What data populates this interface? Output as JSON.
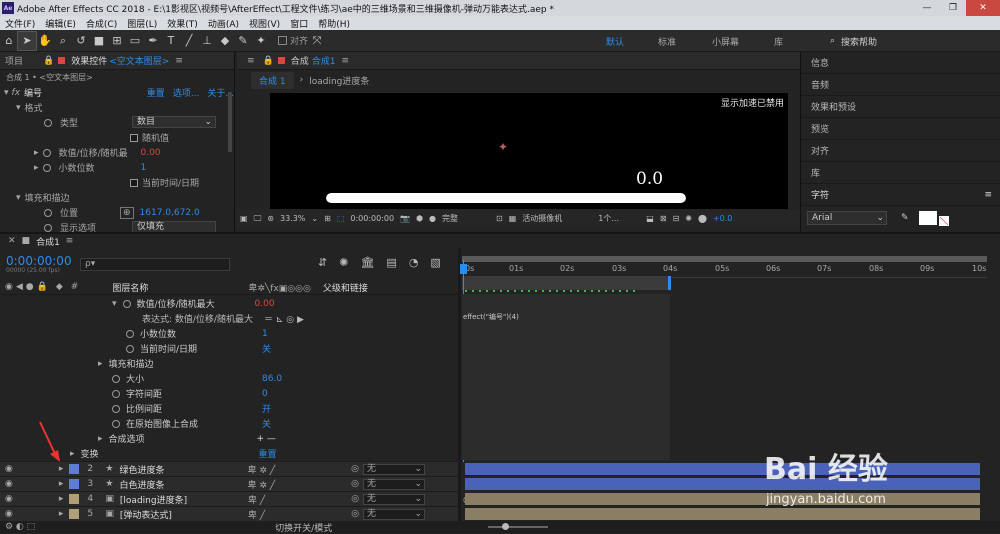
{
  "title": "Adobe After Effects CC 2018 - E:\\1影视区\\视频号\\AfterEffect\\工程文件\\练习\\ae中的三维场景和三维摄像机-弹动万能表达式.aep *",
  "app_icon_text": "Ae",
  "window_buttons": [
    "—",
    "❐",
    "✕"
  ],
  "menu": [
    "文件(F)",
    "编辑(E)",
    "合成(C)",
    "图层(L)",
    "效果(T)",
    "动画(A)",
    "视图(V)",
    "窗口",
    "帮助(H)"
  ],
  "toolbar": {
    "snap_label": "对齐",
    "workspaces": [
      "默认",
      "标准",
      "小屏幕",
      "库"
    ],
    "search_placeholder": "搜索帮助"
  },
  "left_panel": {
    "project_tab": "项目",
    "effects_tab": "效果控件",
    "effects_layer": "<空文本图层>",
    "breadcrumb": "合成 1 • <空文本图层>",
    "effect_name": "编号",
    "reset": "重置",
    "options": "选项...",
    "about": "关于...",
    "rows": [
      {
        "label": "格式"
      },
      {
        "label": "类型",
        "value": "数目"
      },
      {
        "label": "随机值"
      },
      {
        "label": "数值/位移/随机最",
        "value": "0.00"
      },
      {
        "label": "小数位数",
        "value": "1"
      },
      {
        "label": "当前时间/日期"
      },
      {
        "label": "填充和描边"
      },
      {
        "label": "位置",
        "value": "1617.0,672.0"
      },
      {
        "label": "显示选项",
        "value": "仅填充"
      }
    ]
  },
  "comp_panel": {
    "tab": "合成",
    "comp_name": "合成1",
    "sub_tabs": [
      "合成 1",
      "loading进度条"
    ],
    "viewer_text": "0.0",
    "accel_disabled": "显示加速已禁用",
    "zoom": "33.3%",
    "timecode": "0:00:00:00",
    "quality": "完整",
    "camera": "活动摄像机",
    "view": "1个...",
    "exposure": "+0.0",
    "loader_progress": 1.0
  },
  "right_panel": {
    "items": [
      "信息",
      "音频",
      "效果和预设",
      "预览",
      "对齐",
      "库",
      "字符"
    ],
    "font": "Arial"
  },
  "timeline": {
    "comp_tab": "合成1",
    "timecode": "0:00:00:00",
    "frame_info": "00000 (25.00 fps)",
    "search_placeholder": "ρ▾",
    "col_layer_name": "图层名称",
    "col_parent": "父级和链接",
    "time_ticks": [
      "0s",
      "01s",
      "02s",
      "03s",
      "04s",
      "05s",
      "06s",
      "07s",
      "08s",
      "09s",
      "10s"
    ],
    "props": [
      {
        "label": "数值/位移/随机最大",
        "value": "0.00",
        "red": true
      },
      {
        "label": "表达式: 数值/位移/随机最大",
        "value": ""
      },
      {
        "label": "小数位数",
        "value": "1"
      },
      {
        "label": "当前时间/日期",
        "value": "关"
      },
      {
        "label": "填充和描边",
        "value": ""
      },
      {
        "label": "大小",
        "value": "86.0"
      },
      {
        "label": "字符间距",
        "value": "0"
      },
      {
        "label": "比例间距",
        "value": "开"
      },
      {
        "label": "在原始图像上合成",
        "value": "关"
      },
      {
        "label": "合成选项",
        "value": "+ —"
      },
      {
        "label": "变换",
        "value": "重置"
      }
    ],
    "expression": "effect(\"编号\")(4)",
    "layers": [
      {
        "num": "2",
        "name": "绿色进度条",
        "parent": "无",
        "color": "#5b7cd9",
        "bar": "#4a63b8"
      },
      {
        "num": "3",
        "name": "白色进度条",
        "parent": "无",
        "color": "#5b7cd9",
        "bar": "#4a63b8"
      },
      {
        "num": "4",
        "name": "[loading进度条]",
        "parent": "无",
        "color": "#b0a078",
        "bar": "#8a7f64"
      },
      {
        "num": "5",
        "name": "[弹动表达式]",
        "parent": "无",
        "color": "#b0a078",
        "bar": "#8a7f64"
      }
    ],
    "footer_label": "切换开关/模式"
  },
  "watermark": {
    "brand": "Bai 经验",
    "url": "jingyan.baidu.com"
  }
}
